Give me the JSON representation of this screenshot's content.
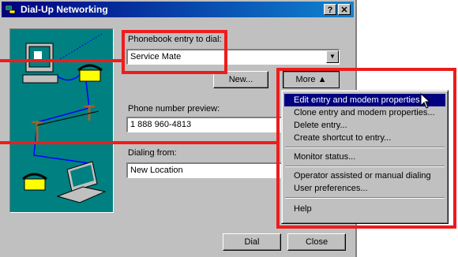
{
  "window": {
    "title": "Dial-Up Networking",
    "help_btn": "?",
    "close_btn": "✕"
  },
  "phonebook": {
    "label": "Phonebook entry to dial:",
    "value": "Service Mate",
    "new_button": "New...",
    "more_button": "More ▲"
  },
  "phone_preview": {
    "label": "Phone number preview:",
    "value": "1 888 960-4813"
  },
  "dialing_from": {
    "label": "Dialing from:",
    "value": "New Location"
  },
  "buttons": {
    "dial": "Dial",
    "close": "Close"
  },
  "more_menu": {
    "items": [
      "Edit entry and modem properties...",
      "Clone entry and modem properties...",
      "Delete entry...",
      "Create shortcut to entry...",
      "Monitor status...",
      "Operator assisted or manual dialing",
      "User preferences...",
      "Help"
    ],
    "selected_index": 0
  },
  "colors": {
    "highlight_box": "#ee1c1c",
    "title_bar": "#000080",
    "illustration_bg": "#008080"
  }
}
